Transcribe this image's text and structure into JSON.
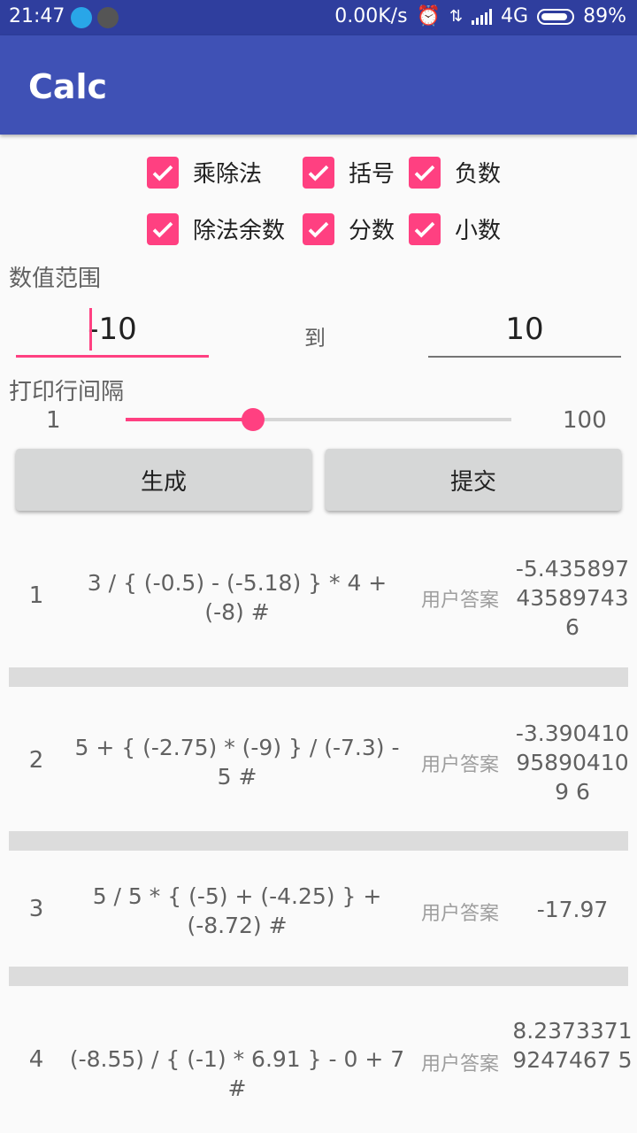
{
  "status_bar": {
    "time": "21:47",
    "speed": "0.00K/s",
    "network": "4G",
    "battery": "89%",
    "icons": [
      "search-app-icon",
      "tiktok-icon",
      "alarm-icon",
      "data-icon",
      "signal-icon",
      "battery-icon"
    ]
  },
  "app_bar": {
    "title": "Calc"
  },
  "options": [
    {
      "label": "乘除法",
      "checked": true
    },
    {
      "label": "括号",
      "checked": true
    },
    {
      "label": "负数",
      "checked": true
    },
    {
      "label": "除法余数",
      "checked": true
    },
    {
      "label": "分数",
      "checked": true
    },
    {
      "label": "小数",
      "checked": true
    }
  ],
  "range": {
    "label": "数值范围",
    "from": "-10",
    "to_label": "到",
    "to": "10"
  },
  "spacing": {
    "label": "打印行间隔",
    "min": "1",
    "max": "100",
    "value": 33
  },
  "buttons": {
    "generate": "生成",
    "submit": "提交"
  },
  "problems": [
    {
      "num": "1",
      "expr": "3 / { (-0.5) - (-5.18) } * 4 + (-8) #",
      "answer_label": "用户答案",
      "result": "-5.43589743589743 6"
    },
    {
      "num": "2",
      "expr": "5 + { (-2.75) * (-9) } / (-7.3) - 5 #",
      "answer_label": "用户答案",
      "result": "-3.390410958904109 6"
    },
    {
      "num": "3",
      "expr": "5 / 5 * { (-5) + (-4.25) } + (-8.72) #",
      "answer_label": "用户答案",
      "result": "-17.97"
    },
    {
      "num": "4",
      "expr": "(-8.55) / { (-1) * 6.91 } - 0 + 7 #",
      "answer_label": "用户答案",
      "result": "8.23733719247467 5"
    }
  ],
  "colors": {
    "primary": "#3f51b5",
    "primary_dark": "#2f3e9e",
    "accent": "#ff4081"
  }
}
